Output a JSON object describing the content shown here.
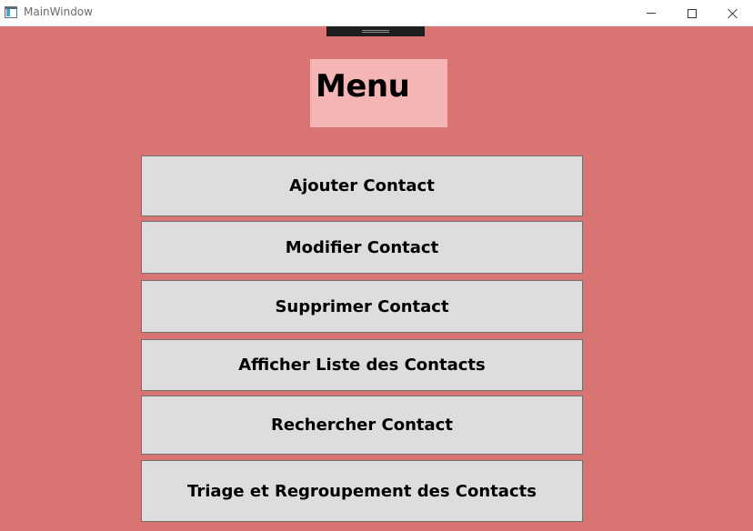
{
  "window": {
    "title": "MainWindow",
    "icons": {
      "app": "window-app-icon",
      "minimize": "minimize-icon",
      "maximize": "maximize-icon",
      "close": "close-icon"
    }
  },
  "menu": {
    "title": "Menu",
    "buttons": [
      {
        "label": "Ajouter Contact"
      },
      {
        "label": "Modifier Contact"
      },
      {
        "label": "Supprimer Contact"
      },
      {
        "label": "Afficher Liste des Contacts"
      },
      {
        "label": "Rechercher Contact"
      },
      {
        "label": "Triage et Regroupement des Contacts"
      }
    ]
  },
  "colors": {
    "background": "#d87572",
    "title_box": "#f5b5b5",
    "button_bg": "#dddddd",
    "button_border": "#707070",
    "debug_toolbar": "#1e1e1e"
  }
}
